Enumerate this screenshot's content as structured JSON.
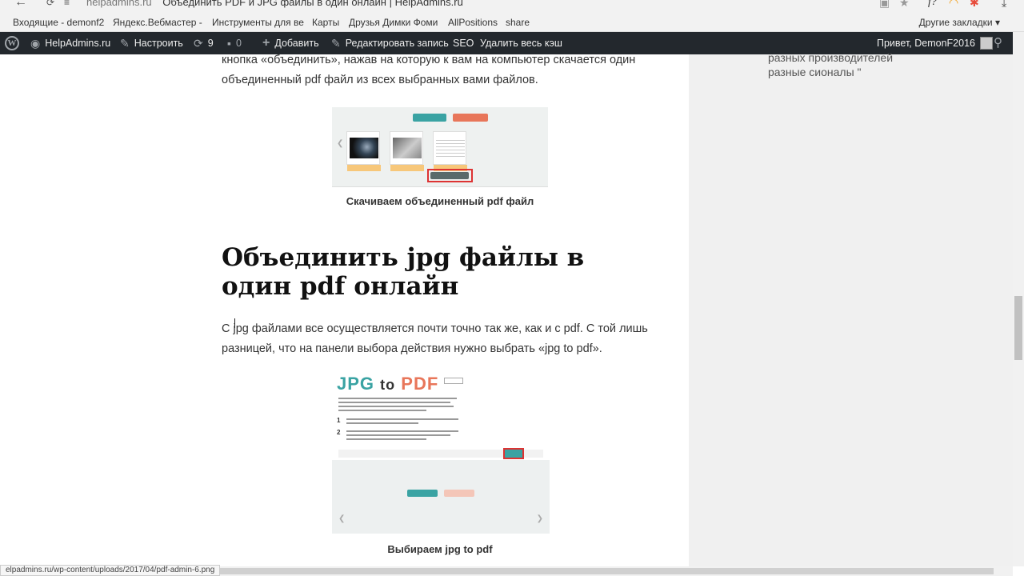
{
  "browser": {
    "url_host": "helpadmins.ru",
    "page_title": "Объединить PDF и JPG файлы в один онлайн | HelpAdmins.ru",
    "bookmarks": [
      "Входящие - demonf2",
      "Яндекс.Вебмастер - ",
      "Инструменты для ве",
      "Карты",
      "Друзья Димки Фоми",
      "AllPositions",
      "share"
    ],
    "other_bookmarks": "Другие закладки",
    "status_url": "elpadmins.ru/wp-content/uploads/2017/04/pdf-admin-6.png"
  },
  "adminbar": {
    "site_name": "HelpAdmins.ru",
    "customize": "Настроить",
    "updates_count": "9",
    "comments_count": "0",
    "add_new": "Добавить",
    "edit_post": "Редактировать запись",
    "seo": "SEO",
    "clear_cache": "Удалить весь кэш",
    "greeting": "Привет, DemonF2016"
  },
  "article": {
    "para1": "кнопка «объединить», нажав на которую к вам на компьютер скачается один объединенный pdf файл из всех выбранных вами файлов.",
    "caption1": "Скачиваем объединенный pdf файл",
    "heading": "Объединить jpg файлы в один pdf онлайн",
    "para2": "С jpg файлами все осуществляется почти точно так же, как и с pdf. С той лишь разницей, что на панели выбора действия нужно выбрать «jpg to pdf».",
    "caption2": "Выбираем jpg to pdf"
  },
  "img2": {
    "logo_jpg": "JPG",
    "logo_to": "to",
    "logo_pdf": "PDF"
  },
  "sidebar": {
    "quote_line1": "разных производителей",
    "quote_line2": "разные сионалы \""
  },
  "colors": {
    "adminbar": "#23282d",
    "accent_teal": "#3aa3a3",
    "accent_red": "#d33333",
    "accent_orange": "#e8765a"
  }
}
